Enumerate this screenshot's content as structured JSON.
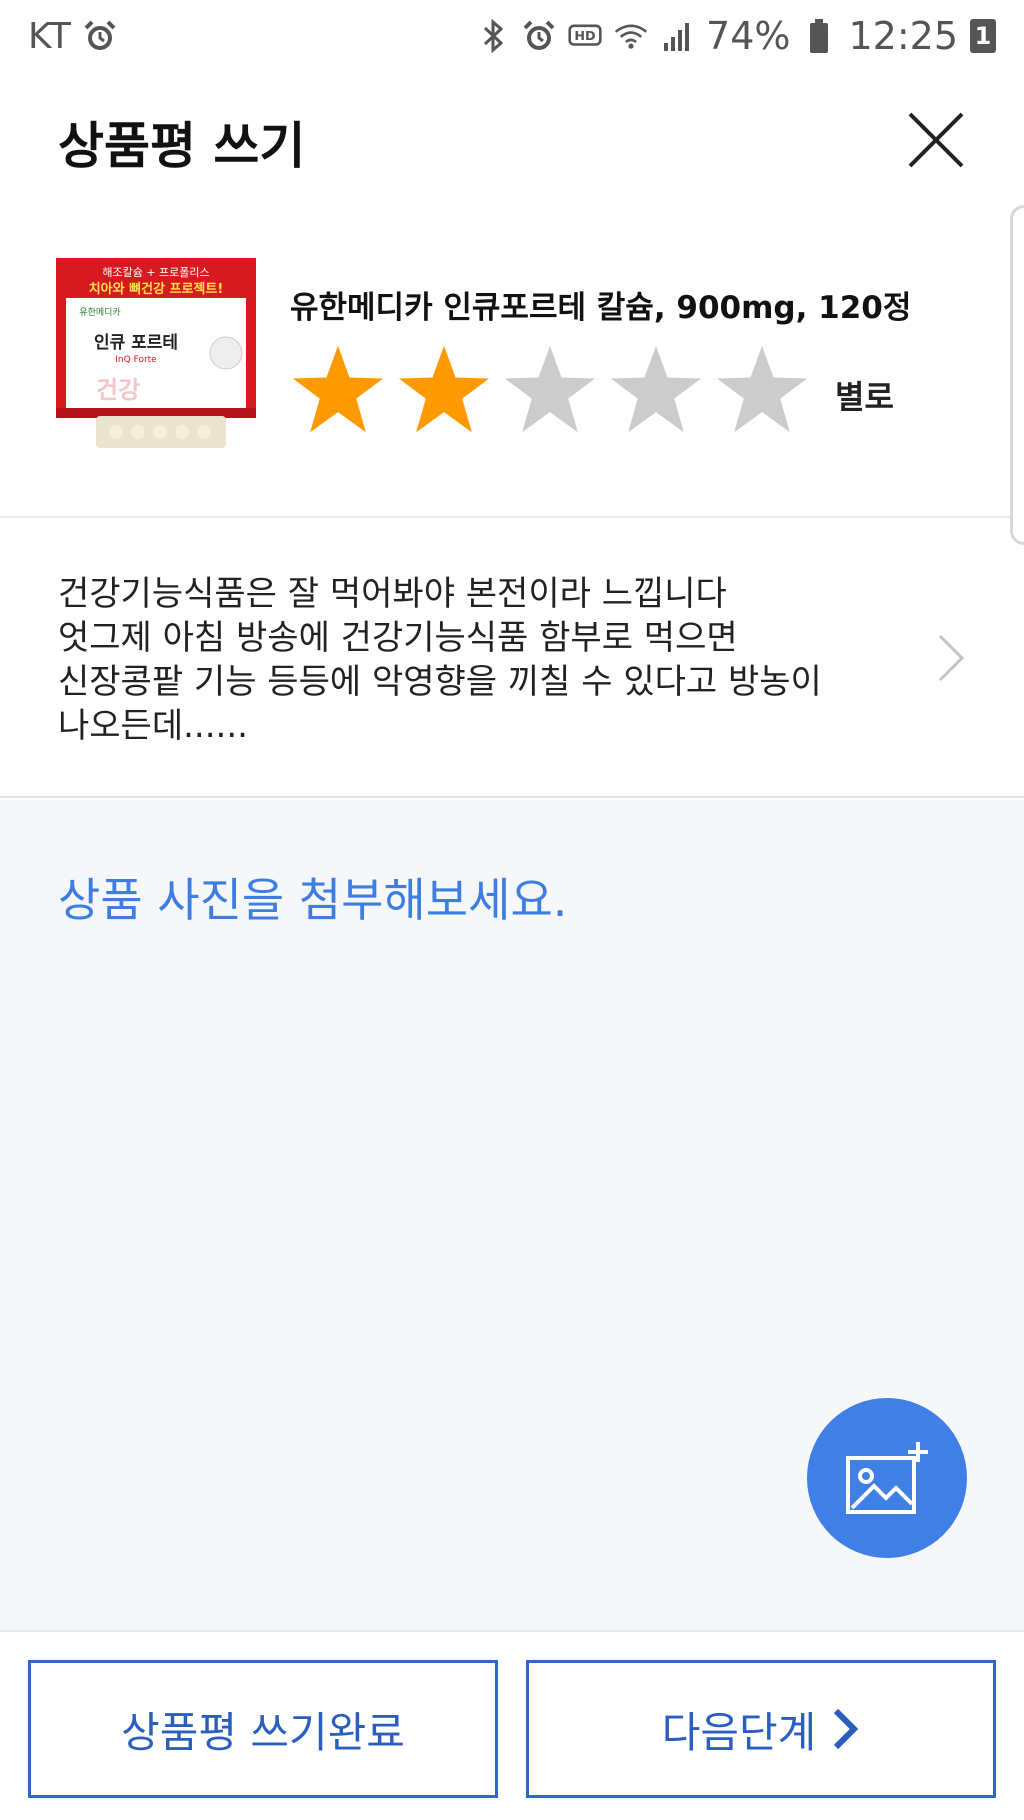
{
  "status_bar": {
    "carrier": "KT",
    "battery": "74%",
    "time": "12:25",
    "notification_count": "1",
    "icons": [
      "alarm-icon",
      "bluetooth-icon",
      "alarm-icon",
      "hd-voice-icon",
      "wifi-icon",
      "signal-icon",
      "battery-icon"
    ]
  },
  "header": {
    "title": "상품평 쓰기",
    "close_icon": "close-icon"
  },
  "product": {
    "name": "유한메디카 인큐포르테 칼슘, 900mg, 120정",
    "rating": 2,
    "max_rating": 5,
    "rating_label": "별로",
    "thumbnail_texts": {
      "top": "해조칼슘 + 프로폴리스",
      "headline": "치아와 뼈건강 프로젝트!",
      "brand": "유한메디카",
      "name": "인큐 포르테",
      "name_en": "InQ Forte",
      "stamp": "건강"
    }
  },
  "review": {
    "lines": [
      "건강기능식품은 잘 먹어봐야 본전이라 느낍니다",
      "엇그제 아침 방송에 건강기능식품 함부로 먹으면",
      "신장콩팥 기능 등등에 악영향을 끼칠 수 있다고 방농이",
      "나오든데......"
    ]
  },
  "photo": {
    "prompt": "상품 사진을 첨부해보세요."
  },
  "buttons": {
    "complete_label": "상품평 쓰기완료",
    "next_label": "다음단계"
  },
  "colors": {
    "accent": "#3f7fe6",
    "star_filled": "#ff9900",
    "star_empty": "#cccccc",
    "button_border": "#2f66c9"
  }
}
